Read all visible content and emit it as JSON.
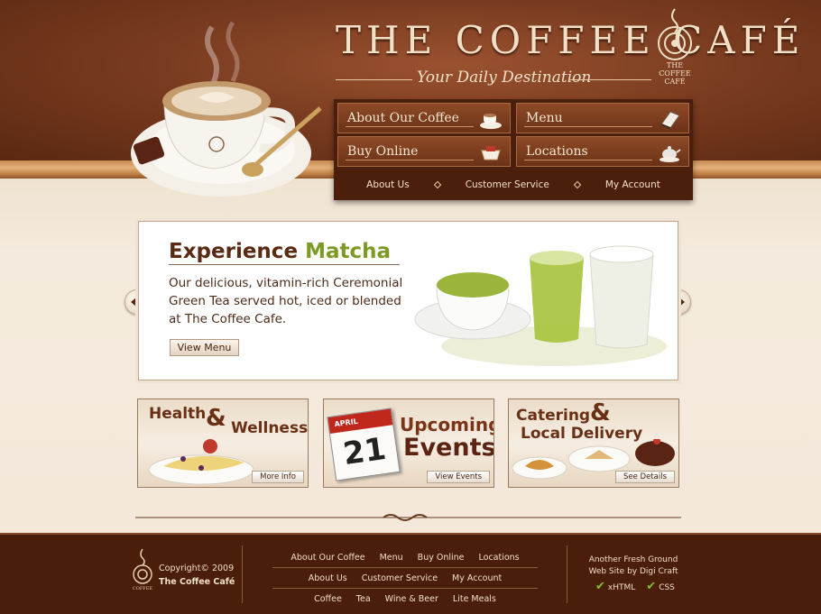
{
  "brand": {
    "title": "THE COFFEE CAFÉ",
    "tagline": "Your Daily Destination",
    "logo_text": [
      "THE",
      "COFFEE",
      "CAFÉ"
    ]
  },
  "nav": {
    "tiles": [
      {
        "label": "About Our Coffee",
        "icon": "coffee-cup-icon"
      },
      {
        "label": "Menu",
        "icon": "menu-book-icon"
      },
      {
        "label": "Buy Online",
        "icon": "basket-icon"
      },
      {
        "label": "Locations",
        "icon": "teapot-icon"
      }
    ],
    "sub": [
      "About Us",
      "Customer Service",
      "My Account"
    ]
  },
  "banner": {
    "title_main": "Experience",
    "title_accent": "Matcha",
    "text": "Our delicious, vitamin-rich Ceremonial Green Tea served hot, iced or blended at The Coffee Cafe.",
    "button": "View Menu",
    "prev_icon": "arrow-left-icon",
    "next_icon": "arrow-right-icon"
  },
  "promos": [
    {
      "title_a": "Health",
      "amp": "&",
      "title_b": "Wellness",
      "button": "More Info"
    },
    {
      "cal_month": "APRIL",
      "cal_day": "21",
      "title_a": "Upcoming",
      "title_b": "Events",
      "button": "View Events"
    },
    {
      "title_a": "Catering",
      "amp": "&",
      "title_b": "Local Delivery",
      "button": "See Details"
    }
  ],
  "footer": {
    "copyright": "Copyright© 2009",
    "company": "The Coffee Café",
    "links_row1": [
      "About Our Coffee",
      "Menu",
      "Buy Online",
      "Locations"
    ],
    "links_row2": [
      "About Us",
      "Customer Service",
      "My Account"
    ],
    "links_row3": [
      "Coffee",
      "Tea",
      "Wine & Beer",
      "Lite Meals"
    ],
    "credit_line1": "Another Fresh Ground",
    "credit_line2": "Web Site by Digi Craft",
    "valid": [
      "xHTML",
      "CSS"
    ]
  },
  "colors": {
    "header_brown": "#7a3c20",
    "nav_dark": "#4c1f0c",
    "accent_green": "#7d9a23",
    "cream": "#f3e8da"
  }
}
